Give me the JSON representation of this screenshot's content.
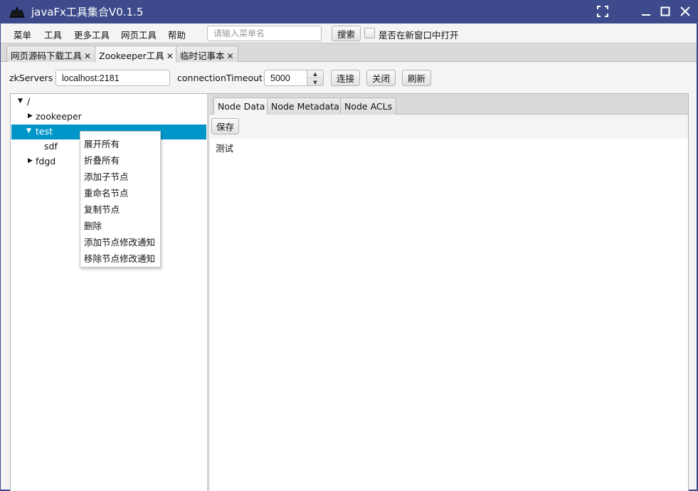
{
  "window": {
    "title": "javaFx工具集合V0.1.5"
  },
  "menubar": {
    "items": [
      "菜单",
      "工具",
      "更多工具",
      "网页工具",
      "帮助"
    ],
    "search_placeholder": "请输入菜单名",
    "search_button": "搜索",
    "new_window_label": "是否在新窗口中打开",
    "new_window_checked": false
  },
  "tabs": [
    {
      "label": "网页源码下载工具",
      "active": false
    },
    {
      "label": "Zookeeper工具",
      "active": true
    },
    {
      "label": "临时记事本",
      "active": false
    }
  ],
  "toolbar": {
    "zk_servers_label": "zkServers",
    "zk_servers_value": "localhost:2181",
    "timeout_label": "connectionTimeout",
    "timeout_value": "5000",
    "connect_button": "连接",
    "close_button": "关闭",
    "refresh_button": "刷新"
  },
  "tree": {
    "nodes": [
      {
        "label": "/",
        "expanded": true,
        "level": 0
      },
      {
        "label": "zookeeper",
        "expanded": false,
        "level": 1
      },
      {
        "label": "test",
        "expanded": true,
        "level": 1,
        "selected": true
      },
      {
        "label": "sdf",
        "level": 2
      },
      {
        "label": "fdgd",
        "expanded": false,
        "level": 1
      }
    ],
    "selected_color": "#0096c9"
  },
  "context_menu": {
    "items": [
      "展开所有",
      "折叠所有",
      "添加子节点",
      "重命名节点",
      "复制节点",
      "删除",
      "添加节点修改通知",
      "移除节点修改通知"
    ]
  },
  "detail": {
    "tabs": [
      "Node Data",
      "Node Metadata",
      "Node ACLs"
    ],
    "active_tab": "Node Data",
    "save_button": "保存",
    "content": "测试"
  }
}
